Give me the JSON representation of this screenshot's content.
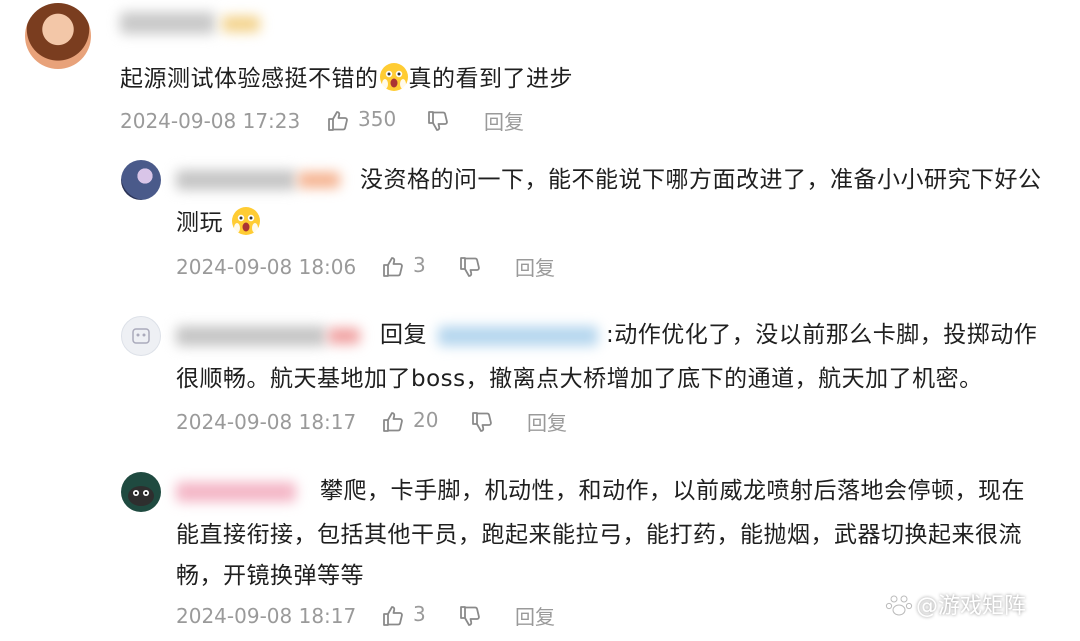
{
  "comments": [
    {
      "text": "起源测试体验感挺不错的",
      "text_after_emoji": "真的看到了进步",
      "time": "2024-09-08 17:23",
      "likes": "350",
      "reply_label": "回复"
    },
    {
      "text_line1": "没资格的问一下，能不能说下哪方面改进了，准备小小研究下好公",
      "text_line2": "测玩",
      "time": "2024-09-08 18:06",
      "likes": "3",
      "reply_label": "回复"
    },
    {
      "reply_prefix": "回复",
      "text_line1": ":动作优化了，没以前那么卡脚，投掷动作",
      "text_line2": "很顺畅。航天基地加了boss，撤离点大桥增加了底下的通道，航天加了机密。",
      "time": "2024-09-08 18:17",
      "likes": "20",
      "reply_label": "回复"
    },
    {
      "text_line1": "攀爬，卡手脚，机动性，和动作，以前威龙喷射后落地会停顿，现在",
      "text_line2": "能直接衔接，包括其他干员，跑起来能拉弓，能打药，能抛烟，武器切换起来很流",
      "text_line3": "畅，开镜换弹等等",
      "time": "2024-09-08 18:17",
      "likes": "3",
      "reply_label": "回复"
    }
  ],
  "watermark": "@游戏矩阵",
  "colors": {
    "text": "#1f1f1f",
    "meta": "#9a9a9a",
    "background": "#ffffff"
  },
  "icons": [
    "avatar",
    "thumbs-up-icon",
    "thumbs-down-icon",
    "emoji-shocked-icon",
    "watermark-logo-icon"
  ]
}
